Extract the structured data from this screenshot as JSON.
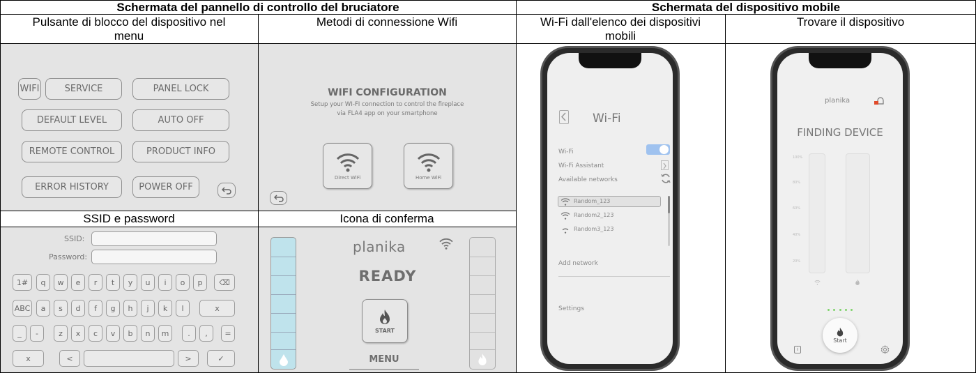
{
  "headers": {
    "burner_panel": "Schermata del pannello di controllo del bruciatore",
    "mobile": "Schermata del dispositivo mobile"
  },
  "subheaders": {
    "lock": "Pulsante di blocco del dispositivo nel menu",
    "wifi_methods": "Metodi di connessione Wifi",
    "wifi_list": "Wi-Fi dall'elenco dei dispositivi mobili",
    "finding": "Trovare il dispositivo",
    "ssid": "SSID e password",
    "confirm": "Icona di conferma"
  },
  "menu": {
    "wifi": "WIFI",
    "service": "SERVICE",
    "panel_lock": "PANEL LOCK",
    "default_level": "DEFAULT LEVEL",
    "auto_off": "AUTO OFF",
    "remote_control": "REMOTE CONTROL",
    "product_info": "PRODUCT INFO",
    "error_history": "ERROR HISTORY",
    "power_off": "POWER OFF"
  },
  "wifi_config": {
    "title": "WIFI CONFIGURATION",
    "line1": "Setup your WI-FI connection to control the fireplace",
    "line2": "via FLA4 app on your smartphone",
    "direct": "Direct WiFi",
    "home": "Home WiFi"
  },
  "keyboard": {
    "ssid_label": "SSID:",
    "password_label": "Password:",
    "row1": [
      "1#",
      "q",
      "w",
      "e",
      "r",
      "t",
      "y",
      "u",
      "i",
      "o",
      "p",
      "⌫"
    ],
    "row2": [
      "ABC",
      "a",
      "s",
      "d",
      "f",
      "g",
      "h",
      "j",
      "k",
      "l",
      "x"
    ],
    "row3": [
      "_",
      "-",
      "z",
      "x",
      "c",
      "v",
      "b",
      "n",
      "m",
      ".",
      ",",
      "="
    ],
    "row4_left": "x",
    "row4_lt": "<",
    "row4_gt": ">",
    "row4_ok": "✓"
  },
  "ready_screen": {
    "brand": "planika",
    "status": "READY",
    "start": "START",
    "menu": "MENU"
  },
  "wifi_phone": {
    "title": "Wi-Fi",
    "wifi": "Wi-Fi",
    "assistant": "Wi-Fi Assistant",
    "available": "Available networks",
    "networks": [
      "Random_123",
      "Random2_123",
      "Random3_123"
    ],
    "add": "Add network",
    "settings": "Settings"
  },
  "finding_phone": {
    "brand": "planika",
    "status": "FINDING DEVICE",
    "ticks": [
      "100%",
      "80%",
      "60%",
      "40%",
      "20%"
    ],
    "start": "Start"
  },
  "colors": {
    "panel_bg": "#e4e4e4",
    "accent_blue": "#bfe3ec",
    "toggle_blue": "#9fc2ef",
    "dots_green": "#7ed36a"
  }
}
